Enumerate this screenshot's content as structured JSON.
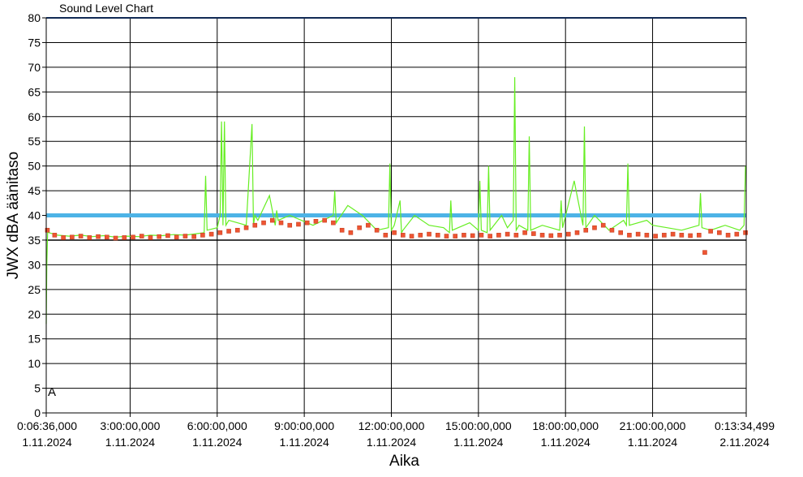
{
  "chart_data": {
    "type": "line",
    "title": "Sound Level Chart",
    "xlabel": "Aika",
    "ylabel": "JWX dBA äänitaso",
    "ylim": [
      0,
      80
    ],
    "yticks": [
      0,
      5,
      10,
      15,
      20,
      25,
      30,
      35,
      40,
      45,
      50,
      55,
      60,
      65,
      70,
      75,
      80
    ],
    "xlim_hours": [
      0.11,
      24.226
    ],
    "x_ticks": [
      {
        "hour": 0.11,
        "time": "0:06:36,000",
        "date": "1.11.2024"
      },
      {
        "hour": 3,
        "time": "3:00:00,000",
        "date": "1.11.2024"
      },
      {
        "hour": 6,
        "time": "6:00:00,000",
        "date": "1.11.2024"
      },
      {
        "hour": 9,
        "time": "9:00:00,000",
        "date": "1.11.2024"
      },
      {
        "hour": 12,
        "time": "12:00:00,000",
        "date": "1.11.2024"
      },
      {
        "hour": 15,
        "time": "15:00:00,000",
        "date": "1.11.2024"
      },
      {
        "hour": 18,
        "time": "18:00:00,000",
        "date": "1.11.2024"
      },
      {
        "hour": 21,
        "time": "21:00:00,000",
        "date": "1.11.2024"
      },
      {
        "hour": 24.226,
        "time": "0:13:34,499",
        "date": "2.11.2024"
      }
    ],
    "grid": true,
    "marker_label": "A",
    "reference_lines": [
      {
        "value": 40,
        "color": "#4db3e6"
      },
      {
        "value": 35,
        "color": "#000000"
      }
    ],
    "colors": {
      "line": "#66ee22",
      "markers": "#ee5533",
      "marker_border": "#c84020",
      "top_line": "#2255aa"
    },
    "series": [
      {
        "style": "markers",
        "x_hours": [
          0.15,
          0.4,
          0.7,
          1.0,
          1.3,
          1.6,
          1.9,
          2.2,
          2.5,
          2.8,
          3.1,
          3.4,
          3.7,
          4.0,
          4.3,
          4.6,
          4.9,
          5.2,
          5.5,
          5.8,
          6.1,
          6.4,
          6.7,
          7.0,
          7.3,
          7.6,
          7.9,
          8.2,
          8.5,
          8.8,
          9.1,
          9.4,
          9.7,
          10.0,
          10.3,
          10.6,
          10.9,
          11.2,
          11.5,
          11.8,
          12.1,
          12.4,
          12.7,
          13.0,
          13.3,
          13.6,
          13.9,
          14.2,
          14.5,
          14.8,
          15.1,
          15.4,
          15.7,
          16.0,
          16.3,
          16.6,
          16.9,
          17.2,
          17.5,
          17.8,
          18.1,
          18.4,
          18.7,
          19.0,
          19.3,
          19.6,
          19.9,
          20.2,
          20.5,
          20.8,
          21.1,
          21.4,
          21.7,
          22.0,
          22.3,
          22.6,
          22.8,
          23.0,
          23.3,
          23.6,
          23.9,
          24.2
        ],
        "y": [
          37,
          36,
          35.5,
          35.6,
          35.8,
          35.5,
          35.7,
          35.6,
          35.4,
          35.5,
          35.6,
          35.8,
          35.5,
          35.7,
          35.9,
          35.6,
          35.8,
          35.7,
          36,
          36.2,
          36.5,
          36.8,
          37,
          37.5,
          38,
          38.5,
          39,
          38.5,
          38,
          38.2,
          38.5,
          38.8,
          39,
          38.5,
          37,
          36.5,
          37.5,
          38,
          37,
          36,
          36.5,
          36,
          35.8,
          36,
          36.2,
          36,
          35.8,
          35.8,
          36,
          35.9,
          36,
          35.8,
          36,
          36.2,
          36,
          36.5,
          36.3,
          36,
          35.9,
          36,
          36.2,
          36.5,
          37,
          37.5,
          38,
          37,
          36.5,
          36,
          36.2,
          36,
          35.8,
          36,
          36.2,
          36,
          35.9,
          36,
          32.5,
          36.8,
          36.5,
          36,
          36.2,
          36.5
        ]
      },
      {
        "style": "line",
        "x_hours": [
          0.11,
          0.13,
          0.16,
          0.2,
          0.5,
          0.9,
          1.3,
          1.7,
          2.1,
          2.5,
          2.9,
          3.3,
          3.7,
          4.1,
          4.5,
          4.9,
          5.3,
          5.55,
          5.6,
          5.65,
          6.0,
          6.1,
          6.15,
          6.2,
          6.25,
          6.3,
          6.4,
          7.0,
          7.2,
          7.25,
          7.3,
          7.4,
          7.8,
          8.0,
          8.05,
          8.1,
          8.5,
          8.9,
          9.3,
          10.0,
          10.05,
          10.1,
          10.5,
          11.0,
          11.5,
          11.9,
          11.95,
          12.0,
          12.1,
          12.3,
          12.35,
          12.4,
          12.8,
          13.3,
          13.8,
          14.0,
          14.05,
          14.1,
          14.7,
          15.0,
          15.05,
          15.1,
          15.3,
          15.35,
          15.4,
          15.8,
          16.0,
          16.2,
          16.25,
          16.3,
          16.4,
          16.7,
          16.75,
          16.8,
          17.2,
          17.8,
          17.85,
          17.9,
          18.3,
          18.6,
          18.65,
          18.7,
          19.0,
          19.5,
          20.0,
          20.1,
          20.15,
          20.2,
          20.8,
          21.0,
          21.5,
          22.0,
          22.6,
          22.65,
          22.7,
          23.0,
          23.5,
          24.0,
          24.15,
          24.2
        ],
        "y": [
          18,
          30,
          37,
          36.5,
          36,
          35.8,
          36,
          35.7,
          35.9,
          35.6,
          35.8,
          35.7,
          36,
          35.9,
          36.1,
          36,
          36.3,
          36.5,
          48,
          37,
          37.5,
          40,
          59,
          38,
          59,
          38,
          39,
          38,
          58.5,
          38,
          40,
          39,
          44,
          38,
          41,
          39,
          40,
          39,
          38,
          40,
          45,
          38.5,
          42,
          40,
          37,
          37.5,
          50.5,
          37,
          38,
          43,
          36.5,
          37,
          40,
          38,
          37.5,
          36.5,
          43,
          37,
          38.5,
          37,
          47,
          37,
          36.5,
          50,
          37,
          40,
          37.5,
          39,
          68,
          37,
          38,
          37,
          56,
          37,
          38,
          37,
          43,
          37.5,
          47,
          38,
          58,
          37.5,
          40,
          37,
          39,
          38,
          50.5,
          38,
          39,
          38,
          37.5,
          37,
          38,
          44.5,
          37.5,
          37,
          38,
          37,
          38,
          50
        ]
      }
    ]
  }
}
